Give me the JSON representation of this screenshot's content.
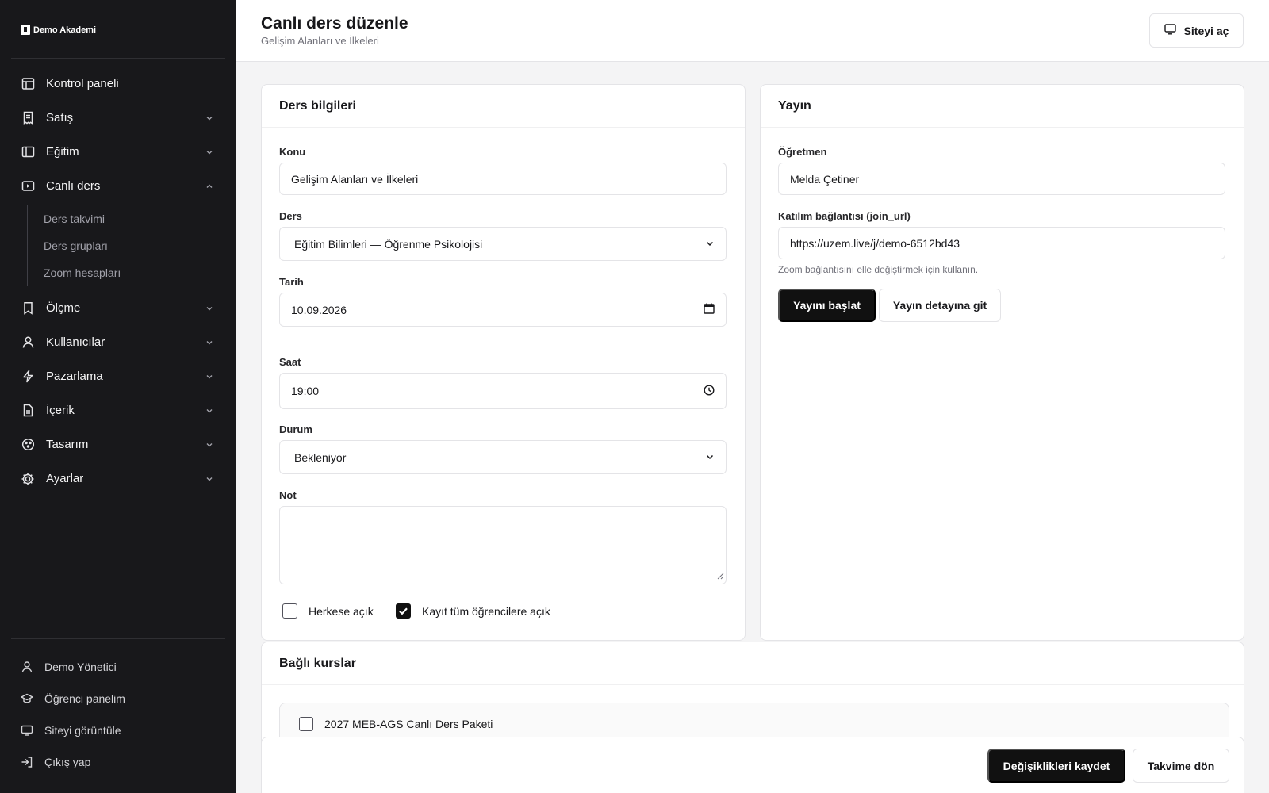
{
  "brand": {
    "name": "Demo Akademi"
  },
  "sidebar": {
    "items": [
      {
        "label": "Kontrol paneli",
        "icon": "dashboard-icon"
      },
      {
        "label": "Satış",
        "icon": "receipt-icon"
      },
      {
        "label": "Eğitim",
        "icon": "book-icon"
      },
      {
        "label": "Canlı ders",
        "icon": "video-icon"
      },
      {
        "label": "Ölçme",
        "icon": "bookmark-icon"
      },
      {
        "label": "Kullanıcılar",
        "icon": "user-icon"
      },
      {
        "label": "Pazarlama",
        "icon": "lightning-icon"
      },
      {
        "label": "İçerik",
        "icon": "file-icon"
      },
      {
        "label": "Tasarım",
        "icon": "palette-icon"
      },
      {
        "label": "Ayarlar",
        "icon": "gear-icon"
      }
    ],
    "sub_items": [
      "Ders takvimi",
      "Ders grupları",
      "Zoom hesapları"
    ],
    "bottom": [
      {
        "label": "Demo Yönetici",
        "icon": "user-icon"
      },
      {
        "label": "Öğrenci panelim",
        "icon": "graduation-cap-icon"
      },
      {
        "label": "Siteyi görüntüle",
        "icon": "monitor-icon"
      },
      {
        "label": "Çıkış yap",
        "icon": "logout-icon"
      }
    ]
  },
  "header": {
    "title": "Canlı ders düzenle",
    "subtitle": "Gelişim Alanları ve İlkeleri",
    "site_button": "Siteyi aç"
  },
  "lesson_card": {
    "title": "Ders bilgileri",
    "topic_label": "Konu",
    "topic_value": "Gelişim Alanları ve İlkeleri",
    "course_label": "Ders",
    "course_value": "Eğitim Bilimleri — Öğrenme Psikolojisi",
    "date_label": "Tarih",
    "date_value": "10.09.2026",
    "time_label": "Saat",
    "time_value": "19:00",
    "status_label": "Durum",
    "status_value": "Bekleniyor",
    "note_label": "Not",
    "note_value": "",
    "public_label": "Herkese açık",
    "public_checked": false,
    "enroll_label": "Kayıt tüm öğrencilere açık",
    "enroll_checked": true
  },
  "broadcast_card": {
    "title": "Yayın",
    "teacher_label": "Öğretmen",
    "teacher_value": "Melda Çetiner",
    "join_label": "Katılım bağlantısı (join_url)",
    "join_value": "https://uzem.live/j/demo-6512bd43",
    "join_hint": "Zoom bağlantısını elle değiştirmek için kullanın.",
    "start_button": "Yayını başlat",
    "detail_button": "Yayın detayına git"
  },
  "courses_card": {
    "title": "Bağlı kurslar",
    "items": [
      {
        "label": "2027 MEB-AGS Canlı Ders Paketi",
        "checked": false
      }
    ]
  },
  "footer": {
    "save_button": "Değişiklikleri kaydet",
    "back_button": "Takvime dön"
  },
  "colors": {
    "sidebar_bg": "#18181b",
    "primary": "#111111",
    "border": "#e4e4e7"
  }
}
